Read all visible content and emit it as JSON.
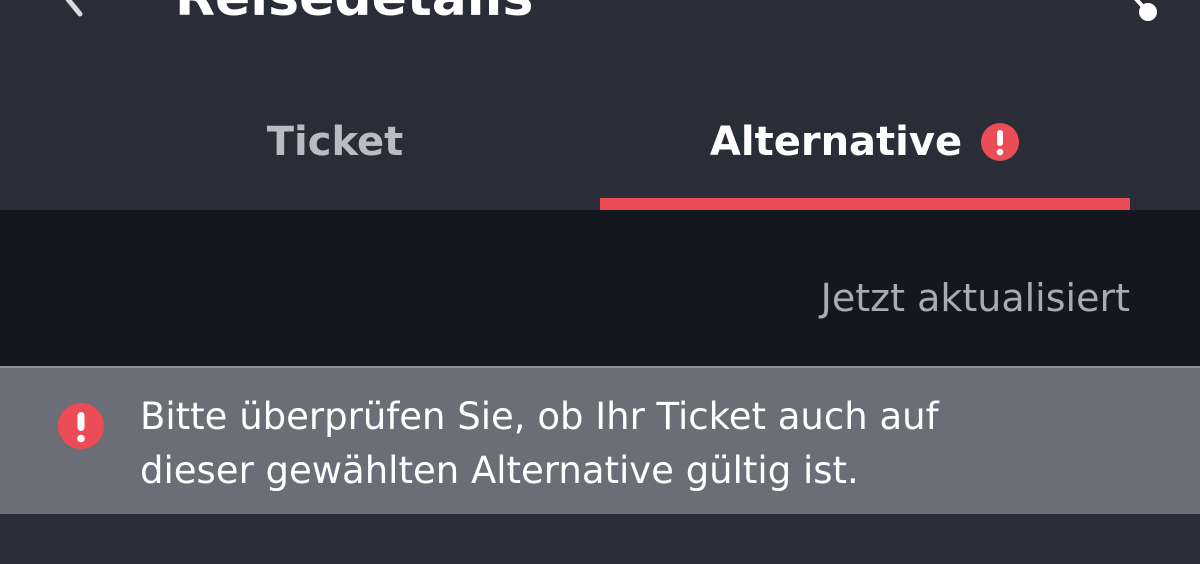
{
  "header": {
    "title": "Reisedetails",
    "back_icon": "chevron-left-icon",
    "share_icon": "share-icon"
  },
  "tabs": [
    {
      "label": "Ticket",
      "active": false
    },
    {
      "label": "Alternative",
      "active": true,
      "alert_icon": "exclamation-circle-icon"
    }
  ],
  "status": {
    "updated_label": "Jetzt aktualisiert"
  },
  "notice": {
    "icon": "exclamation-circle-icon",
    "line1": "Bitte überprüfen Sie, ob Ihr Ticket auch auf",
    "line2": "dieser gewählten Alternative gültig ist."
  },
  "colors": {
    "header_bg": "#2a2d37",
    "strip_bg": "#14171f",
    "banner_bg": "#6b6e77",
    "accent_red": "#ec4c55",
    "text_primary": "#ffffff",
    "text_muted": "#a8abb3"
  }
}
